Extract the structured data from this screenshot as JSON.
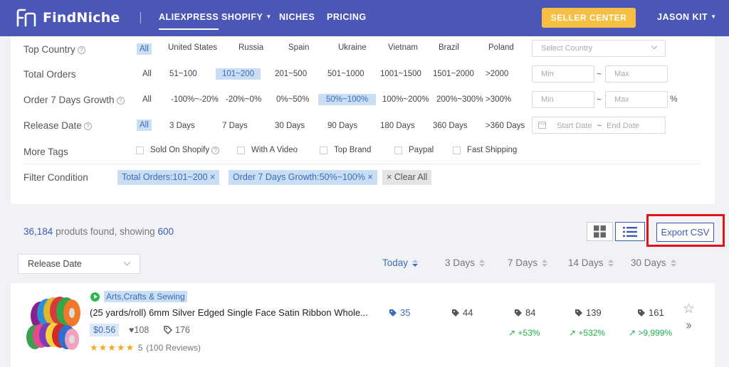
{
  "header": {
    "brand": "FindNiche",
    "nav": [
      {
        "label": "ALIEXPRESS",
        "active": true
      },
      {
        "label": "SHOPIFY",
        "active": false
      },
      {
        "label": "NICHES",
        "active": false
      },
      {
        "label": "PRICING",
        "active": false
      }
    ],
    "seller_center": "SELLER CENTER",
    "user": "JASON KIT"
  },
  "filters": {
    "top_country": {
      "label": "Top Country",
      "options": [
        "All",
        "United States",
        "Russia",
        "Spain",
        "Ukraine",
        "Vietnam",
        "Brazil",
        "Poland"
      ],
      "selected": "All",
      "select_placeholder": "Select Country"
    },
    "total_orders": {
      "label": "Total Orders",
      "options": [
        "All",
        "51~100",
        "101~200",
        "201~500",
        "501~1000",
        "1001~1500",
        "1501~2000",
        ">2000"
      ],
      "selected": "101~200",
      "min_placeholder": "Min",
      "max_placeholder": "Max"
    },
    "growth": {
      "label": "Order 7 Days Growth",
      "options": [
        "All",
        "-100%~-20%",
        "-20%~0%",
        "0%~50%",
        "50%~100%",
        "100%~200%",
        "200%~300%",
        ">300%"
      ],
      "selected": "50%~100%",
      "min_placeholder": "Min",
      "max_placeholder": "Max",
      "unit": "%"
    },
    "release_date": {
      "label": "Release Date",
      "options": [
        "All",
        "3 Days",
        "7 Days",
        "30 Days",
        "90 Days",
        "180 Days",
        "360 Days",
        ">360 Days"
      ],
      "selected": "All",
      "start_placeholder": "Start Date",
      "end_placeholder": "End Date"
    },
    "more_tags": {
      "label": "More Tags",
      "options": [
        "Sold On Shopify",
        "With A Video",
        "Top Brand",
        "Paypal",
        "Fast Shipping"
      ]
    },
    "condition": {
      "label": "Filter Condition",
      "chips": [
        "Total Orders:101~200 ×",
        "Order 7 Days Growth:50%~100% ×"
      ],
      "clear": "× Clear All"
    }
  },
  "results": {
    "count": "36,184",
    "found_text": "produts found, showing",
    "showing": "600",
    "export": "Export CSV",
    "sort": "Release Date",
    "columns": [
      "Today",
      "3 Days",
      "7 Days",
      "14 Days",
      "30 Days"
    ],
    "active_column": "Today"
  },
  "product": {
    "category": "Arts,Crafts & Sewing",
    "title": "(25 yards/roll) 6mm Silver Edged Single Face Satin Ribbon Whole...",
    "price": "$0.56",
    "likes": "108",
    "tags": "176",
    "rating": "★★★★★",
    "rating_value": "5",
    "reviews": "(100 Reviews)",
    "orders": [
      "35",
      "44",
      "84",
      "139",
      "161"
    ],
    "growth": [
      "",
      "",
      "+53%",
      "+532%",
      ">9,999%"
    ]
  },
  "colors": {
    "header_bg": "#4a57b7",
    "accent": "#3a6db7",
    "seller_btn": "#f7c045",
    "highlight_frame": "#e0141b",
    "growth": "#1fb14a"
  }
}
